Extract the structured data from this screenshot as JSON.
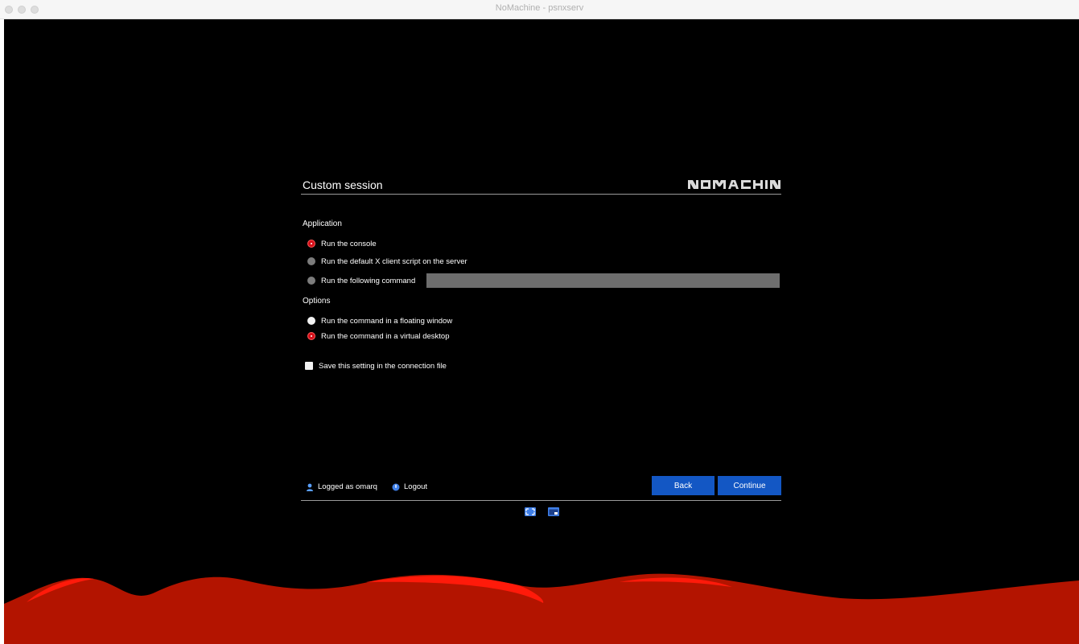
{
  "window": {
    "title": "NoMachine - psnxserv"
  },
  "panel": {
    "title": "Custom session",
    "brand_icon": "nomachine-logo",
    "application": {
      "label": "Application",
      "options": [
        {
          "label": "Run the console",
          "selected": true
        },
        {
          "label": "Run the default X client script on the server",
          "selected": false
        },
        {
          "label": "Run the following command",
          "selected": false
        }
      ],
      "command_value": ""
    },
    "options": {
      "label": "Options",
      "choices": [
        {
          "label": "Run the command in a floating window",
          "selected": false
        },
        {
          "label": "Run the command in a virtual desktop",
          "selected": true
        }
      ]
    },
    "save_setting": {
      "label": "Save this setting in the connection file",
      "checked": false
    },
    "footer": {
      "logged_as": "Logged as omarq",
      "logout": "Logout",
      "back": "Back",
      "continue": "Continue"
    }
  },
  "icons": {
    "user": "user-icon",
    "logout": "power-icon",
    "fullscreen": "fullscreen-icon",
    "window": "window-icon"
  },
  "colors": {
    "accent_blue": "#1357c4",
    "radio_selected": "#d4101a",
    "wave_red": "#b31400",
    "background": "#000000"
  }
}
